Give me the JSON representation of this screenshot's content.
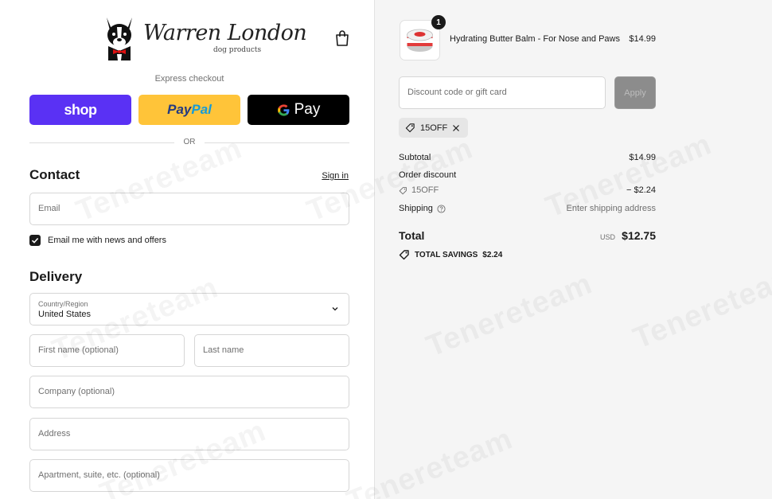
{
  "brand": {
    "name": "Warren London",
    "tagline": "dog products"
  },
  "express": {
    "label": "Express checkout",
    "shop_label": "shop",
    "paypal_part1": "Pay",
    "paypal_part2": "Pal",
    "gpay_label": "Pay",
    "or_label": "OR"
  },
  "contact": {
    "title": "Contact",
    "signin_label": "Sign in",
    "email_placeholder": "Email",
    "newsletter_label": "Email me with news and offers",
    "newsletter_checked": true
  },
  "delivery": {
    "title": "Delivery",
    "country_label": "Country/Region",
    "country_value": "United States",
    "first_name_placeholder": "First name (optional)",
    "last_name_placeholder": "Last name",
    "company_placeholder": "Company (optional)",
    "address_placeholder": "Address",
    "apartment_placeholder": "Apartment, suite, etc. (optional)"
  },
  "order": {
    "product": {
      "name": "Hydrating Butter Balm - For Nose and Paws",
      "price": "$14.99",
      "quantity": "1"
    },
    "discount_placeholder": "Discount code or gift card",
    "apply_label": "Apply",
    "applied_code": "15OFF",
    "subtotal_label": "Subtotal",
    "subtotal_value": "$14.99",
    "order_discount_label": "Order discount",
    "discount_code": "15OFF",
    "discount_value": "− $2.24",
    "shipping_label": "Shipping",
    "shipping_value": "Enter shipping address",
    "total_label": "Total",
    "currency": "USD",
    "total_value": "$12.75",
    "savings_label": "TOTAL SAVINGS",
    "savings_value": "$2.24"
  },
  "watermark": "Tenereteam",
  "colors": {
    "shop": "#5a31f4",
    "paypal": "#ffc439",
    "gpay": "#000000",
    "apply_disabled": "#8c8c8c",
    "summary_bg": "#f5f5f5"
  }
}
